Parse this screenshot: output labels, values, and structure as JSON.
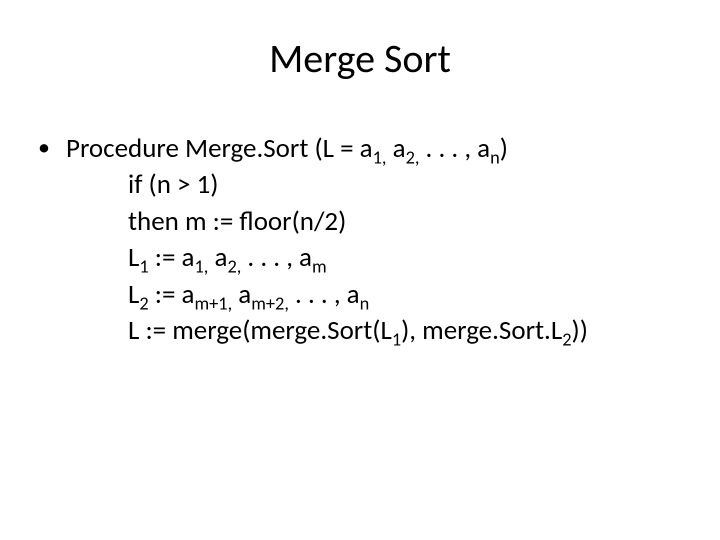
{
  "title": "Merge Sort",
  "bullet": {
    "line1": {
      "pre": "Procedure Merge.Sort (L = a",
      "s1": "1,",
      "mid1": " a",
      "s2": "2,",
      "mid2": " . . . , a",
      "s3": "n",
      "post": ")"
    }
  },
  "lines": {
    "l2": "if (n > 1)",
    "l3": "then m := floor(n/2)",
    "l4": {
      "a": "L",
      "s1": "1",
      "b": " := a",
      "s2": "1,",
      "c": " a",
      "s3": "2,",
      "d": " . . . , a",
      "s4": "m"
    },
    "l5": {
      "a": "L",
      "s1": "2",
      "b": " := a",
      "s2": "m+1,",
      "c": " a",
      "s3": "m+2,",
      "d": " . . . , a",
      "s4": "n"
    },
    "l6": {
      "a": "L := merge(merge.Sort(L",
      "s1": "1",
      "b": "), merge.Sort.L",
      "s2": "2",
      "c": "))"
    }
  }
}
